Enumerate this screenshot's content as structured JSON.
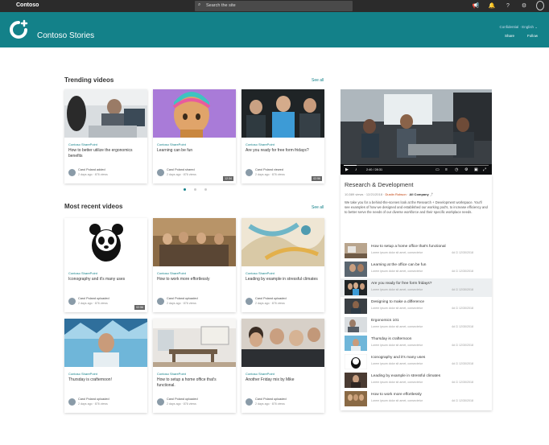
{
  "topbar": {
    "brand": "Contoso",
    "search_placeholder": "Search the site"
  },
  "header": {
    "site_title": "Contoso Stories",
    "meta": "Confidential · English ⌄",
    "actions": [
      "Share",
      "Follow"
    ]
  },
  "trending": {
    "title": "Trending videos",
    "see_all": "See all",
    "cards": [
      {
        "source": "Contoso SharePoint",
        "title": "How to better utilize the ergonomics benefits",
        "author": "Carol Poland added",
        "stats": "2 days ago · 876 views",
        "duration": ""
      },
      {
        "source": "Contoso SharePoint",
        "title": "Learning can be fun",
        "author": "Carol Poland shared",
        "stats": "2 days ago · 876 views",
        "duration": "12:34"
      },
      {
        "source": "Contoso SharePoint",
        "title": "Are you ready for free form fridays?",
        "author": "Carol Poland viewed",
        "stats": "2 days ago · 876 views",
        "duration": "02:56"
      }
    ]
  },
  "recent": {
    "title": "Most recent videos",
    "see_all": "See all",
    "cards": [
      {
        "source": "Contoso SharePoint",
        "title": "Iconography and it's many uses",
        "author": "Carol Poland uploaded",
        "stats": "2 days ago · 876 views",
        "duration": "02:56"
      },
      {
        "source": "Contoso SharePoint",
        "title": "How to work more effortlessly",
        "author": "Carol Poland uploaded",
        "stats": "2 days ago · 876 views",
        "duration": ""
      },
      {
        "source": "Contoso SharePoint",
        "title": "Leading by example in stressful climates",
        "author": "Carol Poland uploaded",
        "stats": "2 days ago · 876 views",
        "duration": ""
      },
      {
        "source": "Contoso SharePoint",
        "title": "Thursday is crafternoon!",
        "author": "Carol Poland uploaded",
        "stats": "2 days ago · 876 views",
        "duration": ""
      },
      {
        "source": "Contoso SharePoint",
        "title": "How to setup a home office that's functional.",
        "author": "Carol Poland uploaded",
        "stats": "2 days ago · 876 views",
        "duration": ""
      },
      {
        "source": "Contoso SharePoint",
        "title": "Another Friday mix by Mike",
        "author": "Carol Poland uploaded",
        "stats": "2 days ago · 876 views",
        "duration": ""
      }
    ]
  },
  "player": {
    "time": "2:40 / 28:31",
    "progress": 0.09
  },
  "detail": {
    "title": "Research & Development",
    "views": "10,589 views",
    "date": "12/21/2018",
    "owner": "Dustin Robson",
    "group": "All Company",
    "description": "We take you for a behind-the-scenes look at the Research + Development workspace. You'll see examples of how we designed and established our working pod's, to increase efficiency and to better serve the needs of our diverse workforce and their specific workplace needs."
  },
  "playlist": [
    {
      "title": "How to setup a home office that's functional",
      "sub": "Lorem ipsum dolor sit amet, consectetur",
      "meta": "4d ⊡   12/30/2018"
    },
    {
      "title": "Learning at the office can be fun",
      "sub": "Lorem ipsum dolor sit amet, consectetur",
      "meta": "4d ⊡   12/30/2018"
    },
    {
      "title": "Are you ready for free form fridays?",
      "sub": "Lorem ipsum dolor sit amet, consectetur",
      "meta": "4d ⊡   12/30/2018"
    },
    {
      "title": "Designing to make a difference",
      "sub": "Lorem ipsum dolor sit amet, consectetur",
      "meta": "4d ⊡   12/30/2018"
    },
    {
      "title": "Ergonomics 101",
      "sub": "Lorem ipsum dolor sit amet, consectetur",
      "meta": "4d ⊡   12/30/2018"
    },
    {
      "title": "Thursday is crafternoon",
      "sub": "Lorem ipsum dolor sit amet, consectetur",
      "meta": "4d ⊡   12/30/2018"
    },
    {
      "title": "Iconography and it's many uses",
      "sub": "Lorem ipsum dolor sit amet, consectetur",
      "meta": "4d ⊡   12/30/2018"
    },
    {
      "title": "Leading by example in stressful climates",
      "sub": "Lorem ipsum dolor sit amet, consectetur",
      "meta": "4d ⊡   12/30/2018"
    },
    {
      "title": "How to work more effortlessly",
      "sub": "Lorem ipsum dolor sit amet, consectetur",
      "meta": "4d ⊡   12/30/2018"
    }
  ],
  "colors": {
    "accent": "#138189",
    "topbar": "#2b2b2b",
    "link_orange": "#c2410c"
  },
  "icons": [
    "search-icon",
    "megaphone-icon",
    "notification-icon",
    "help-icon",
    "settings-icon",
    "avatar-icon",
    "play-icon",
    "volume-icon",
    "captions-icon",
    "settings-icon",
    "fullscreen-icon"
  ]
}
